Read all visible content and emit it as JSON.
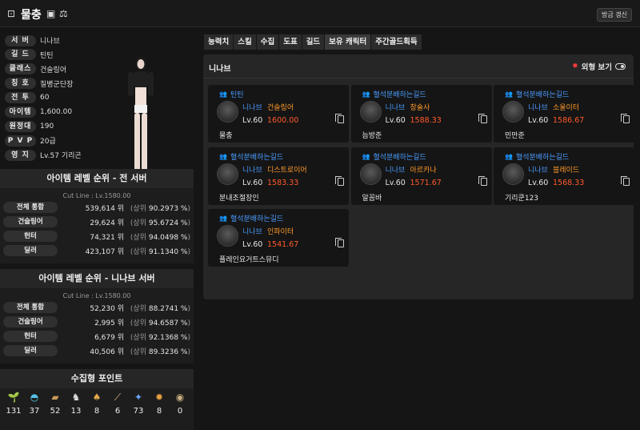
{
  "topbar": {
    "title": "물충",
    "refresh_label": "방금 갱신"
  },
  "profile": {
    "rows": [
      {
        "label": "서 버",
        "value": "니나브"
      },
      {
        "label": "길 드",
        "value": "틴틴"
      },
      {
        "label": "클래스",
        "value": "건슬링어"
      },
      {
        "label": "칭 호",
        "value": "질병군단장"
      },
      {
        "label": "전 투",
        "value": "60"
      },
      {
        "label": "아이템",
        "value": "1,600.00"
      },
      {
        "label": "원정대",
        "value": "190"
      },
      {
        "label": "P V P",
        "value": "20급"
      },
      {
        "label": "영 지",
        "value": "Lv.57 기리곤"
      }
    ]
  },
  "rank_all": {
    "title": "아이템 레벨 순위 - 전 서버",
    "cutline": "Cut Line : Lv.1580.00",
    "rows": [
      {
        "name": "전체 통합",
        "rank": "539,614 위",
        "pct": "90.2973 %"
      },
      {
        "name": "건슬링어",
        "rank": "29,624 위",
        "pct": "95.6724 %"
      },
      {
        "name": "헌터",
        "rank": "74,321 위",
        "pct": "94.0498 %"
      },
      {
        "name": "딜러",
        "rank": "423,107 위",
        "pct": "91.1340 %"
      }
    ]
  },
  "rank_server": {
    "title": "아이템 레벨 순위 - 니나브 서버",
    "cutline": "Cut Line : Lv.1580.00",
    "rows": [
      {
        "name": "전체 통합",
        "rank": "52,230 위",
        "pct": "88.2741 %"
      },
      {
        "name": "건슬링어",
        "rank": "2,995 위",
        "pct": "94.6587 %"
      },
      {
        "name": "헌터",
        "rank": "6,679 위",
        "pct": "92.1368 %"
      },
      {
        "name": "딜러",
        "rank": "40,506 위",
        "pct": "89.3236 %"
      }
    ]
  },
  "rank_labels": {
    "prefix": "(상위",
    "suffix": ")"
  },
  "collect": {
    "title": "수집형 포인트",
    "items": [
      {
        "icon": "seed-icon",
        "glyph": "🌱",
        "value": "131"
      },
      {
        "icon": "island-icon",
        "glyph": "◓",
        "value": "37"
      },
      {
        "icon": "art-icon",
        "glyph": "▰",
        "value": "52"
      },
      {
        "icon": "heart-icon",
        "glyph": "♞",
        "value": "13"
      },
      {
        "icon": "mokoko-icon",
        "glyph": "♠",
        "value": "8"
      },
      {
        "icon": "gem-icon",
        "glyph": "⟋",
        "value": "6"
      },
      {
        "icon": "leaf-icon",
        "glyph": "✦",
        "value": "73"
      },
      {
        "icon": "star-icon",
        "glyph": "✹",
        "value": "8"
      },
      {
        "icon": "orgel-icon",
        "glyph": "◉",
        "value": "0"
      }
    ]
  },
  "tabs": [
    "능력치",
    "스킬",
    "수집",
    "도표",
    "길드",
    "보유 캐릭터",
    "주간골드획득"
  ],
  "active_tab": 5,
  "panel": {
    "server": "니나브",
    "outlook_label": "외형 보기"
  },
  "characters": [
    {
      "guild": "틴틴",
      "server": "니나브",
      "class": "건슬링어",
      "lv": "Lv.60",
      "ilvl": "1600.00",
      "name": "물충"
    },
    {
      "guild": "혈석분배하는길드",
      "server": "니나브",
      "class": "창술사",
      "lv": "Lv.60",
      "ilvl": "1588.33",
      "name": "늠방준"
    },
    {
      "guild": "혈석분배하는길드",
      "server": "니나브",
      "class": "소울이터",
      "lv": "Lv.60",
      "ilvl": "1586.67",
      "name": "민만준"
    },
    {
      "guild": "혈석분배하는길드",
      "server": "니나브",
      "class": "디스트로이어",
      "lv": "Lv.60",
      "ilvl": "1583.33",
      "name": "분내조절장인"
    },
    {
      "guild": "혈석분배하는길드",
      "server": "니나브",
      "class": "아르카나",
      "lv": "Lv.60",
      "ilvl": "1571.67",
      "name": "알꼼바"
    },
    {
      "guild": "혈석분배하는길드",
      "server": "니나브",
      "class": "블레이드",
      "lv": "Lv.60",
      "ilvl": "1568.33",
      "name": "기리쿤123"
    },
    {
      "guild": "혈석분배하는길드",
      "server": "니나브",
      "class": "인파이터",
      "lv": "Lv.60",
      "ilvl": "1541.67",
      "name": "플레인요거트스뮤디"
    }
  ],
  "colors": {
    "guild": "#4a9cff",
    "class": "#ff9a2a",
    "ilvl": "#ff5a2a"
  }
}
